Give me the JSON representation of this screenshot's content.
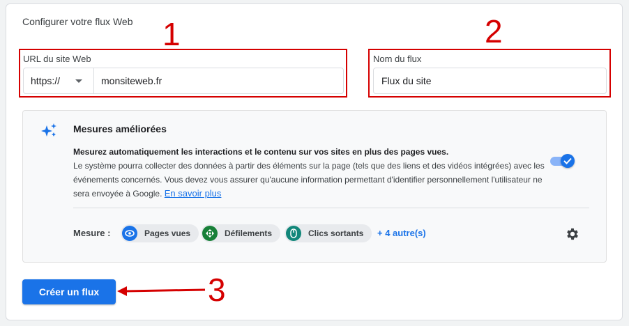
{
  "form": {
    "title": "Configurer votre flux Web",
    "url_label": "URL du site Web",
    "protocol_value": "https://",
    "url_value": "monsiteweb.fr",
    "stream_label": "Nom du flux",
    "stream_value": "Flux du site"
  },
  "annotations": {
    "n1": "1",
    "n2": "2",
    "n3": "3"
  },
  "enhanced": {
    "title": "Mesures améliorées",
    "desc_bold": "Mesurez automatiquement les interactions et le contenu sur vos sites en plus des pages vues.",
    "desc_text": "Le système pourra collecter des données à partir des éléments sur la page (tels que des liens et des vidéos intégrées) avec les événements concernés. Vous devez vous assurer qu'aucune information permettant d'identifier personnellement l'utilisateur ne sera envoyée à Google.",
    "learn_more": "En savoir plus",
    "toggle_on": true,
    "measure_label": "Mesure :",
    "chips": [
      {
        "label": "Pages vues",
        "icon": "eye-icon",
        "color": "#1a73e8"
      },
      {
        "label": "Défilements",
        "icon": "scroll-icon",
        "color": "#188038"
      },
      {
        "label": "Clics sortants",
        "icon": "mouse-icon",
        "color": "#12877a"
      }
    ],
    "more": "+ 4 autre(s)"
  },
  "create_button": "Créer un flux",
  "colors": {
    "accent": "#1a73e8",
    "annotation": "#d50000"
  }
}
